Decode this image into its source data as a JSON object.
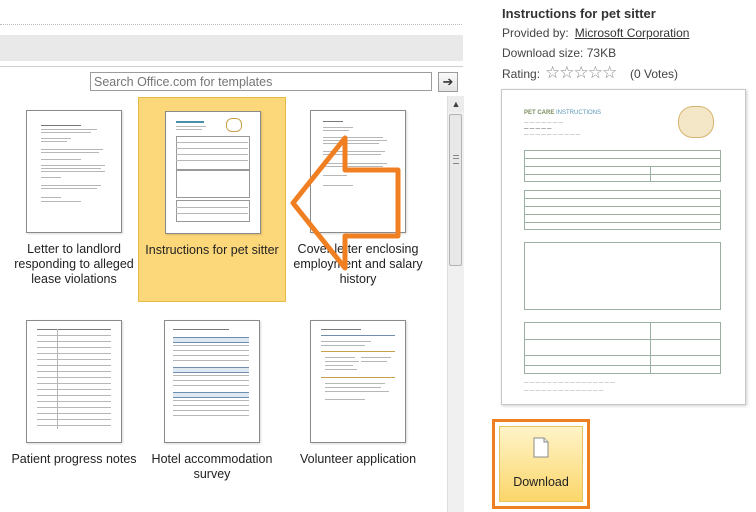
{
  "search": {
    "placeholder": "Search Office.com for templates"
  },
  "templates": [
    {
      "label": "Letter to landlord responding to alleged lease violations",
      "selected": false
    },
    {
      "label": "Instructions for pet sitter",
      "selected": true
    },
    {
      "label": "Cover letter enclosing employment and salary history",
      "selected": false
    },
    {
      "label": "Patient progress notes",
      "selected": false
    },
    {
      "label": "Hotel accommodation survey",
      "selected": false
    },
    {
      "label": "Volunteer application",
      "selected": false
    }
  ],
  "detail": {
    "title": "Instructions for pet sitter",
    "provided_by_label": "Provided by:",
    "provider": "Microsoft Corporation",
    "download_size_label": "Download size:",
    "download_size": "73KB",
    "rating_label": "Rating:",
    "stars": "☆☆☆☆☆",
    "votes": "(0 Votes)",
    "rating_value": 0
  },
  "preview": {
    "brand_main": "PET CARE",
    "brand_sub": "INSTRUCTIONS"
  },
  "download": {
    "label": "Download"
  },
  "colors": {
    "accent": "#f07f22",
    "selected_tile": "#fdd87a",
    "button": "#fbd66a"
  }
}
